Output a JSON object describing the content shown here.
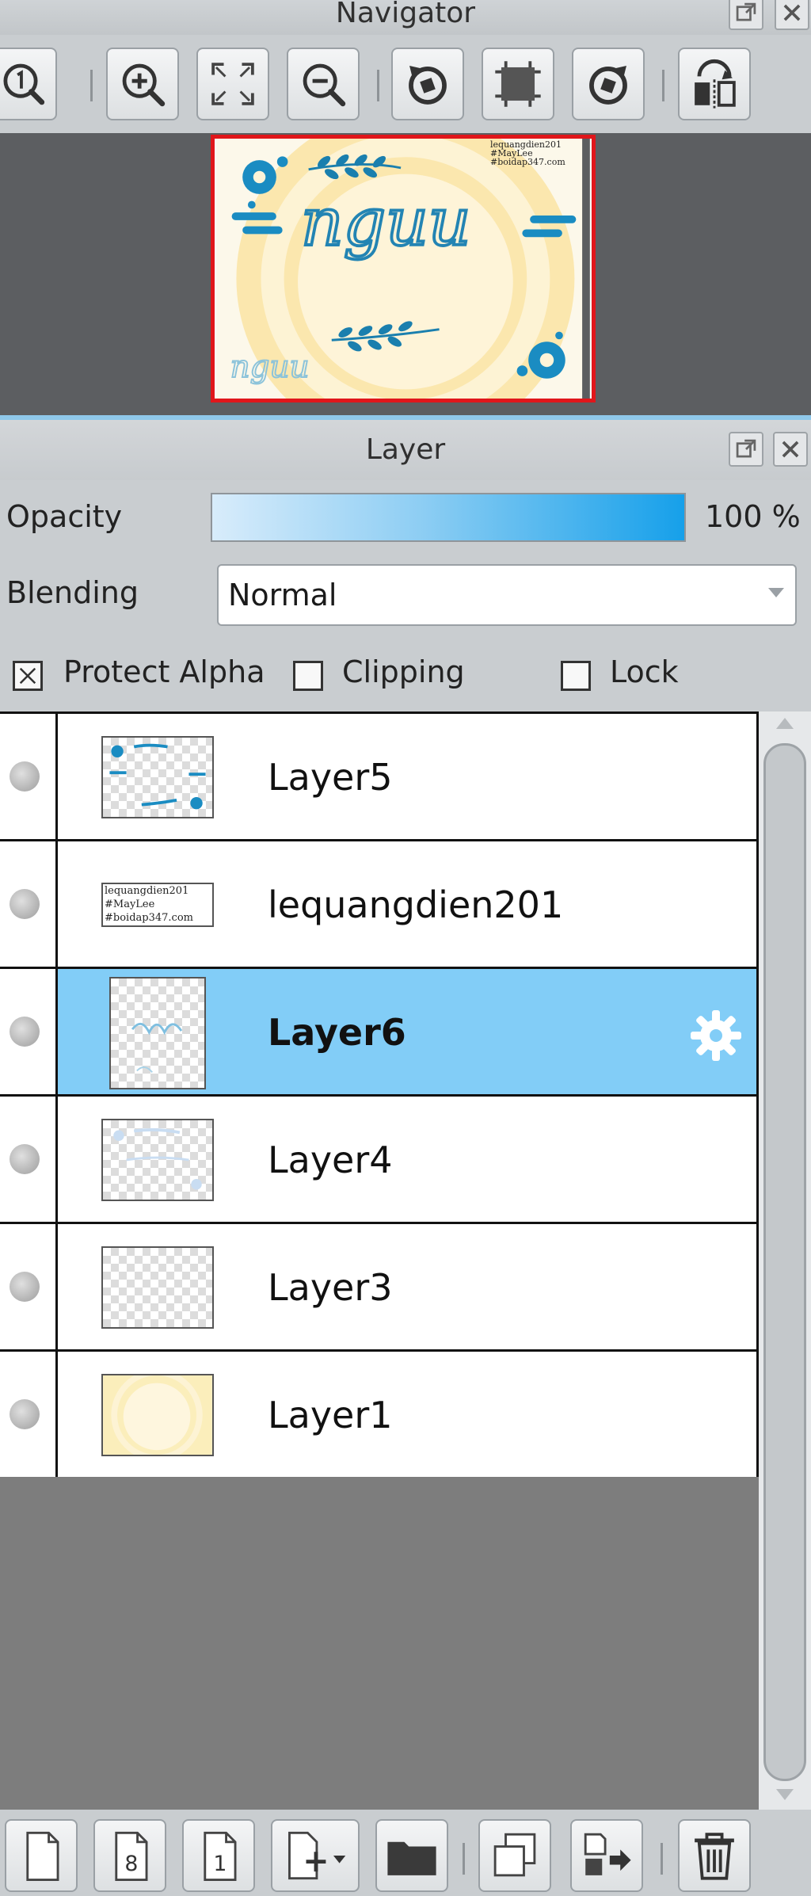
{
  "navigator": {
    "title": "Navigator",
    "toolbar": [
      "zoom-actual-icon",
      "zoom-in-icon",
      "fit-window-icon",
      "zoom-out-icon",
      "rotate-left-icon",
      "reset-rotation-icon",
      "rotate-right-icon",
      "flip-horizontal-icon"
    ],
    "preview": {
      "text": "nguu",
      "watermark": [
        "lequangdien201",
        "#MayLee",
        "#boidap347.com"
      ]
    }
  },
  "layer_panel": {
    "title": "Layer",
    "opacity_label": "Opacity",
    "opacity_value": "100 %",
    "opacity_level": 1.0,
    "blending_label": "Blending",
    "blending_value": "Normal",
    "protect_alpha_label": "Protect Alpha",
    "protect_alpha_checked": true,
    "clipping_label": "Clipping",
    "clipping_checked": false,
    "lock_label": "Lock",
    "lock_checked": false,
    "layers": [
      {
        "name": "Layer5",
        "selected": false
      },
      {
        "name": "lequangdien201",
        "selected": false
      },
      {
        "name": "Layer6",
        "selected": true
      },
      {
        "name": "Layer4",
        "selected": false
      },
      {
        "name": "Layer3",
        "selected": false
      },
      {
        "name": "Layer1",
        "selected": false
      }
    ],
    "bottom_toolbar": [
      "new-layer-icon",
      "new-8bit-layer-icon",
      "new-1bit-layer-icon",
      "add-layer-menu-icon",
      "new-folder-icon",
      "duplicate-layer-icon",
      "merge-down-icon",
      "delete-layer-icon"
    ],
    "bottom_badges": {
      "eight_bit": "8",
      "one_bit": "1"
    }
  },
  "colors": {
    "selection": "#82cdf7",
    "accent": "#16a0ea",
    "navigator_frame": "#e0161b",
    "panel": "#c9cdd0"
  }
}
